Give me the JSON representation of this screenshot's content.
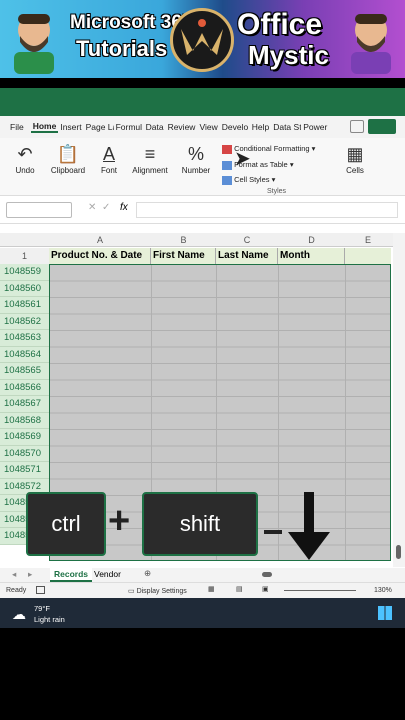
{
  "banner": {
    "line1": "Microsoft 365",
    "line2": "Tutorials",
    "brand1": "Office",
    "brand2": "Mystic"
  },
  "tabs": [
    "File",
    "Home",
    "Insert",
    "Page La",
    "Formul",
    "Data",
    "Review",
    "View",
    "Develo",
    "Help",
    "Data St",
    "Power"
  ],
  "active_tab": "Home",
  "ribbon": {
    "undo": "Undo",
    "clipboard": "Clipboard",
    "font": "Font",
    "alignment": "Alignment",
    "number": "Number",
    "cond_format": "Conditional Formatting",
    "format_table": "Format as Table",
    "cell_styles": "Cell Styles",
    "styles": "Styles",
    "cells": "Cells"
  },
  "formula": {
    "fx": "fx"
  },
  "columns": [
    "A",
    "B",
    "C",
    "D",
    "E"
  ],
  "header_row": {
    "num": "1",
    "cells": [
      "Product No. & Date",
      "First Name",
      "Last Name",
      "Month"
    ]
  },
  "rows": [
    "1048559",
    "1048560",
    "1048561",
    "1048562",
    "1048563",
    "1048564",
    "1048565",
    "1048566",
    "1048567",
    "1048568",
    "1048569",
    "1048570",
    "1048571",
    "1048572",
    "1048573",
    "1048574",
    "1048575"
  ],
  "sheets": {
    "active": "Records",
    "other": "Vendor"
  },
  "status": {
    "ready": "Ready",
    "display": "Display Settings",
    "zoom": "130%"
  },
  "weather": {
    "temp": "79°F",
    "desc": "Light rain"
  },
  "keys": {
    "ctrl": "ctrl",
    "plus": "+",
    "shift": "shift"
  }
}
